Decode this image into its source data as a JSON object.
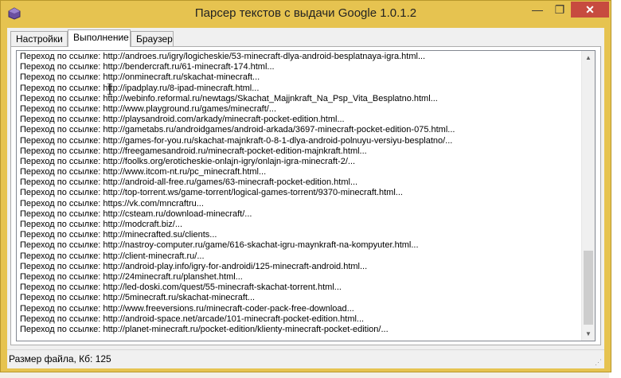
{
  "window": {
    "title": "Парсер текстов с выдачи Google 1.0.1.2",
    "app_icon": "app-icon",
    "buttons": {
      "minimize": "—",
      "maximize": "❐",
      "close": "✕"
    }
  },
  "tabs": [
    {
      "label": "Настройки",
      "active": false
    },
    {
      "label": "Выполнение",
      "active": true
    },
    {
      "label": "Браузер",
      "active": false
    }
  ],
  "log": {
    "lines": [
      "Переход по ссылке: http://androes.ru/igry/logicheskie/53-minecraft-dlya-android-besplatnaya-igra.html...",
      "Переход по ссылке: http://bendercraft.ru/61-minecraft-174.html...",
      "Переход по ссылке: http://onminecraft.ru/skachat-minecraft...",
      "Переход по ссылке: http://ipadplay.ru/8-ipad-minecraft.html...",
      "Переход по ссылке: http://webinfo.reformal.ru/newtags/Skachat_Majjnkraft_Na_Psp_Vita_Besplatno.html...",
      "Переход по ссылке: http://www.playground.ru/games/minecraft/...",
      "Переход по ссылке: http://playsandroid.com/arkady/minecraft-pocket-edition.html...",
      "Переход по ссылке: http://gametabs.ru/androidgames/android-arkada/3697-minecraft-pocket-edition-075.html...",
      "Переход по ссылке: http://games-for-you.ru/skachat-majnkraft-0-8-1-dlya-android-polnuyu-versiyu-besplatno/...",
      "Переход по ссылке: http://freegamesandroid.ru/minecraft-pocket-edition-majnkraft.html...",
      "Переход по ссылке: http://foolks.org/eroticheskie-onlajn-igry/onlajn-igra-minecraft-2/...",
      "Переход по ссылке: http://www.itcom-nt.ru/pc_minecraft.html...",
      "Переход по ссылке: http://android-all-free.ru/games/63-minecraft-pocket-edition.html...",
      "Переход по ссылке: http://top-torrent.ws/game-torrent/logical-games-torrent/9370-minecraft.html...",
      "Переход по ссылке: https://vk.com/mncraftru...",
      "Переход по ссылке: http://csteam.ru/download-minecraft/...",
      "Переход по ссылке: http://modcraft.biz/...",
      "Переход по ссылке: http://minecrafted.su/clients...",
      "Переход по ссылке: http://nastroy-computer.ru/game/616-skachat-igru-maynkraft-na-kompyuter.html...",
      "Переход по ссылке: http://client-minecraft.ru/...",
      "Переход по ссылке: http://android-play.info/igry-for-androidi/125-minecraft-android.html...",
      "Переход по ссылке: http://24minecraft.ru/planshet.html...",
      "Переход по ссылке: http://led-doski.com/quest/55-minecraft-skachat-torrent.html...",
      "Переход по ссылке: http://5minecraft.ru/skachat-minecraft...",
      "Переход по ссылке: http://www.freeversions.ru/minecraft-coder-pack-free-download...",
      "Переход по ссылке: http://android-space.net/arcade/101-minecraft-pocket-edition.html...",
      "Переход по ссылке: http://planet-minecraft.ru/pocket-edition/klienty-minecraft-pocket-edition/..."
    ]
  },
  "status": {
    "text": "Размер файла, Кб: 125"
  },
  "colors": {
    "titlebar": "#e6c350",
    "close": "#c74b3f"
  }
}
